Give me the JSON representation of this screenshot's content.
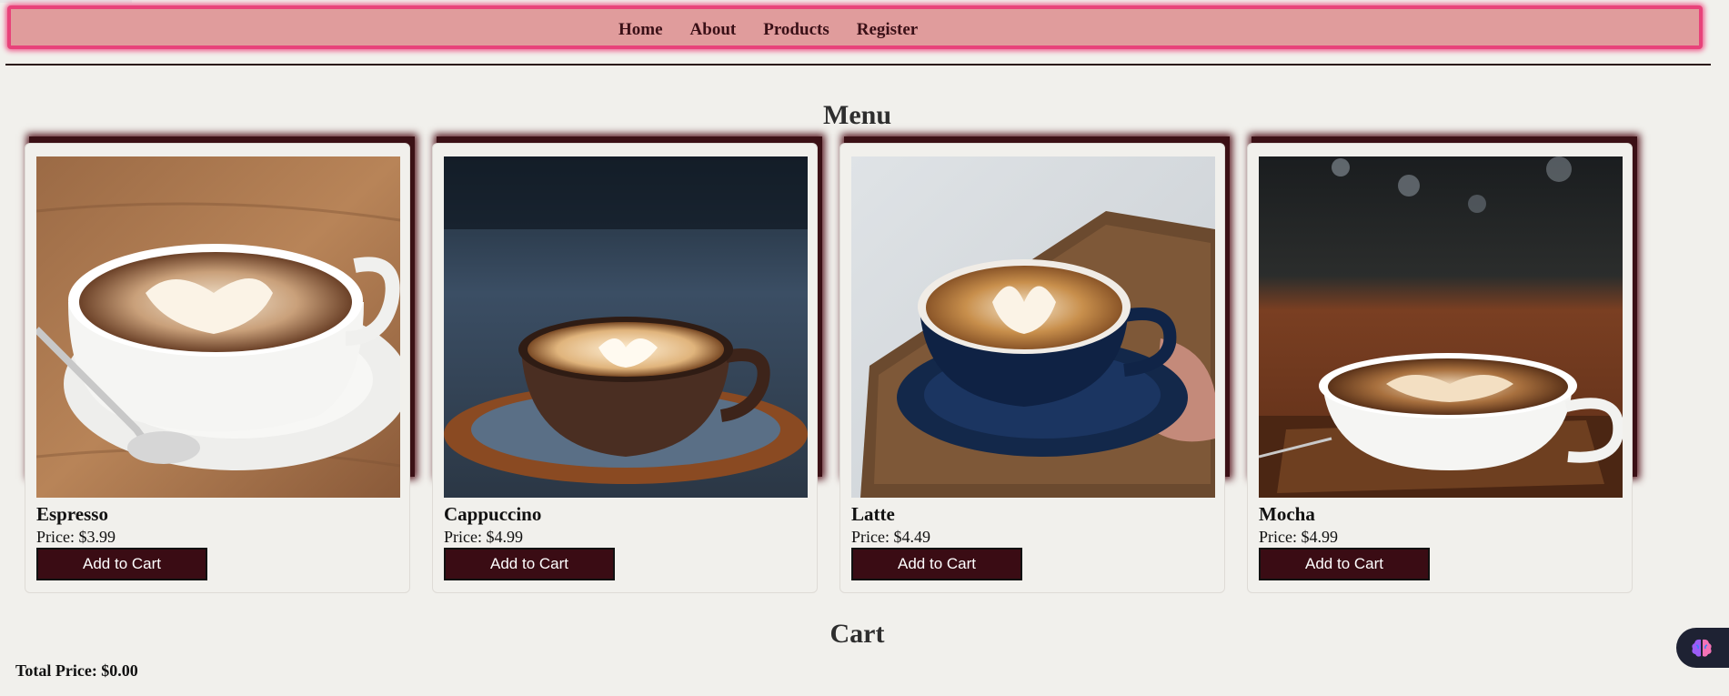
{
  "nav": {
    "links": [
      "Home",
      "About",
      "Products",
      "Register"
    ]
  },
  "menu": {
    "title": "Menu",
    "items": [
      {
        "name": "Espresso",
        "price": "Price: $3.99",
        "button": "Add to Cart",
        "image_icon": "espresso-cup-image"
      },
      {
        "name": "Cappuccino",
        "price": "Price: $4.99",
        "button": "Add to Cart",
        "image_icon": "cappuccino-cup-image"
      },
      {
        "name": "Latte",
        "price": "Price: $4.49",
        "button": "Add to Cart",
        "image_icon": "latte-cup-image"
      },
      {
        "name": "Mocha",
        "price": "Price: $4.99",
        "button": "Add to Cart",
        "image_icon": "mocha-cup-image"
      }
    ]
  },
  "cart": {
    "title": "Cart",
    "total": "Total Price: $0.00"
  },
  "colors": {
    "navbar_bg": "#e09c9c",
    "navbar_border": "#e8427a",
    "button_bg": "#3a0c14",
    "page_bg": "#f1f0ec"
  },
  "floating_button": {
    "icon": "brain-icon"
  }
}
